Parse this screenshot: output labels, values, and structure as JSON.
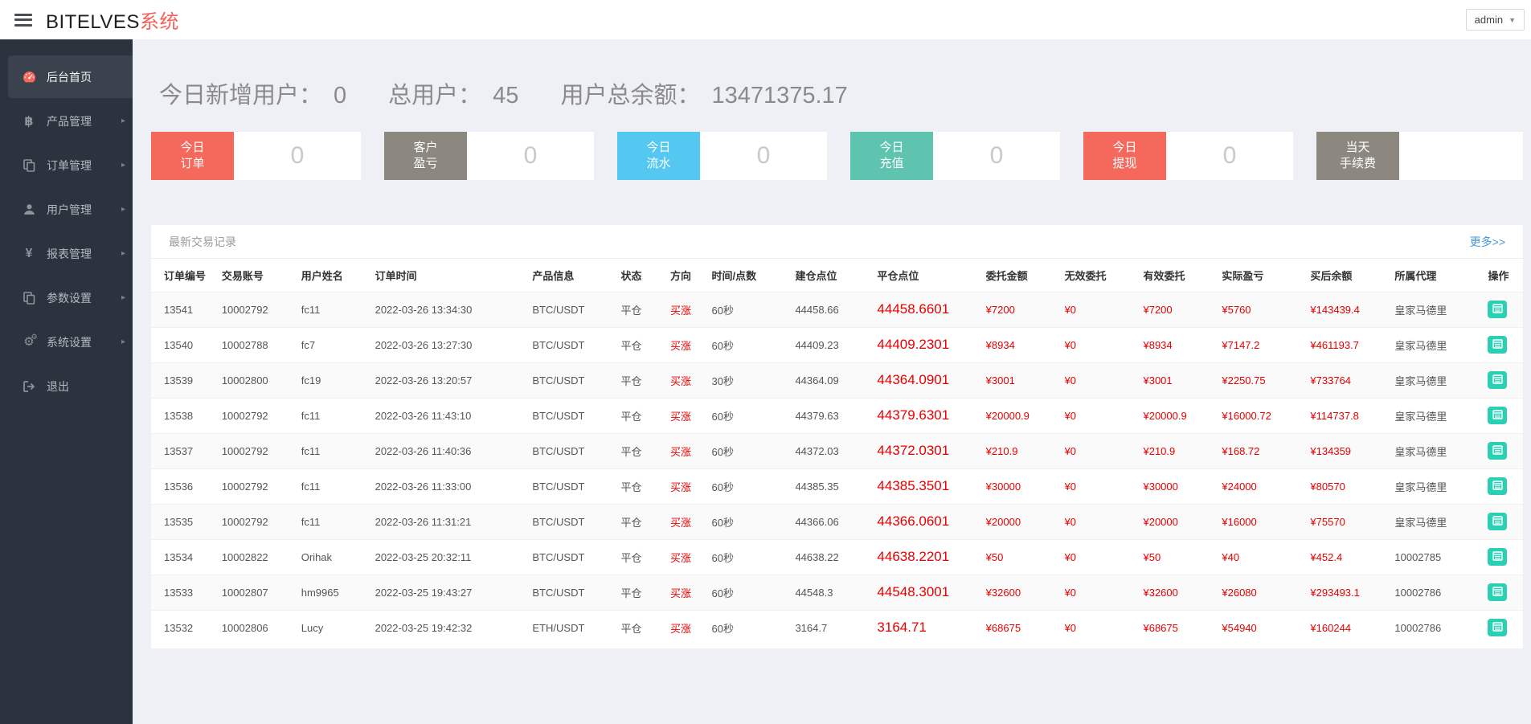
{
  "header": {
    "brand": "BITELVES",
    "brand_suffix": "系统",
    "user_label": "admin"
  },
  "sidebar": {
    "items": [
      {
        "label": "后台首页",
        "icon": "dashboard-icon",
        "active": true,
        "has_arrow": false
      },
      {
        "label": "产品管理",
        "icon": "bitcoin-icon",
        "active": false,
        "has_arrow": true
      },
      {
        "label": "订单管理",
        "icon": "orders-icon",
        "active": false,
        "has_arrow": true
      },
      {
        "label": "用户管理",
        "icon": "user-icon",
        "active": false,
        "has_arrow": true
      },
      {
        "label": "报表管理",
        "icon": "yen-icon",
        "active": false,
        "has_arrow": true
      },
      {
        "label": "参数设置",
        "icon": "params-icon",
        "active": false,
        "has_arrow": true
      },
      {
        "label": "系统设置",
        "icon": "gears-icon",
        "active": false,
        "has_arrow": true
      },
      {
        "label": "退出",
        "icon": "logout-icon",
        "active": false,
        "has_arrow": false
      }
    ]
  },
  "stats": [
    {
      "label": "今日新增用户：",
      "value": "0"
    },
    {
      "label": "总用户：",
      "value": "45"
    },
    {
      "label": "用户总余额：",
      "value": "13471375.17"
    }
  ],
  "cards": [
    {
      "line1": "今日",
      "line2": "订单",
      "value": "0",
      "color": "#f4695c"
    },
    {
      "line1": "客户",
      "line2": "盈亏",
      "value": "0",
      "color": "#8c8880"
    },
    {
      "line1": "今日",
      "line2": "流水",
      "value": "0",
      "color": "#54c8f0"
    },
    {
      "line1": "今日",
      "line2": "充值",
      "value": "0",
      "color": "#5ec4b0"
    },
    {
      "line1": "今日",
      "line2": "提现",
      "value": "0",
      "color": "#f4695c"
    },
    {
      "line1": "当天",
      "line2": "手续费",
      "value": "",
      "color": "#8c8880"
    }
  ],
  "panel": {
    "title": "最新交易记录",
    "more_link": "更多>>"
  },
  "table": {
    "columns": [
      "订单编号",
      "交易账号",
      "用户姓名",
      "订单时间",
      "产品信息",
      "状态",
      "方向",
      "时间/点数",
      "建仓点位",
      "平仓点位",
      "委托金额",
      "无效委托",
      "有效委托",
      "实际盈亏",
      "买后余额",
      "所属代理",
      "操作"
    ],
    "rows": [
      {
        "id": "13541",
        "account": "10002792",
        "name": "fc11",
        "time": "2022-03-26 13:34:30",
        "product": "BTC/USDT",
        "status": "平仓",
        "direction": "买涨",
        "period": "60秒",
        "open_point": "44458.66",
        "close_point": "44458.6601",
        "amount": "¥7200",
        "invalid": "¥0",
        "valid": "¥7200",
        "profit": "¥5760",
        "balance": "¥143439.4",
        "agent": "皇家马德里"
      },
      {
        "id": "13540",
        "account": "10002788",
        "name": "fc7",
        "time": "2022-03-26 13:27:30",
        "product": "BTC/USDT",
        "status": "平仓",
        "direction": "买涨",
        "period": "60秒",
        "open_point": "44409.23",
        "close_point": "44409.2301",
        "amount": "¥8934",
        "invalid": "¥0",
        "valid": "¥8934",
        "profit": "¥7147.2",
        "balance": "¥461193.7",
        "agent": "皇家马德里"
      },
      {
        "id": "13539",
        "account": "10002800",
        "name": "fc19",
        "time": "2022-03-26 13:20:57",
        "product": "BTC/USDT",
        "status": "平仓",
        "direction": "买涨",
        "period": "30秒",
        "open_point": "44364.09",
        "close_point": "44364.0901",
        "amount": "¥3001",
        "invalid": "¥0",
        "valid": "¥3001",
        "profit": "¥2250.75",
        "balance": "¥733764",
        "agent": "皇家马德里"
      },
      {
        "id": "13538",
        "account": "10002792",
        "name": "fc11",
        "time": "2022-03-26 11:43:10",
        "product": "BTC/USDT",
        "status": "平仓",
        "direction": "买涨",
        "period": "60秒",
        "open_point": "44379.63",
        "close_point": "44379.6301",
        "amount": "¥20000.9",
        "invalid": "¥0",
        "valid": "¥20000.9",
        "profit": "¥16000.72",
        "balance": "¥114737.8",
        "agent": "皇家马德里"
      },
      {
        "id": "13537",
        "account": "10002792",
        "name": "fc11",
        "time": "2022-03-26 11:40:36",
        "product": "BTC/USDT",
        "status": "平仓",
        "direction": "买涨",
        "period": "60秒",
        "open_point": "44372.03",
        "close_point": "44372.0301",
        "amount": "¥210.9",
        "invalid": "¥0",
        "valid": "¥210.9",
        "profit": "¥168.72",
        "balance": "¥134359",
        "agent": "皇家马德里"
      },
      {
        "id": "13536",
        "account": "10002792",
        "name": "fc11",
        "time": "2022-03-26 11:33:00",
        "product": "BTC/USDT",
        "status": "平仓",
        "direction": "买涨",
        "period": "60秒",
        "open_point": "44385.35",
        "close_point": "44385.3501",
        "amount": "¥30000",
        "invalid": "¥0",
        "valid": "¥30000",
        "profit": "¥24000",
        "balance": "¥80570",
        "agent": "皇家马德里"
      },
      {
        "id": "13535",
        "account": "10002792",
        "name": "fc11",
        "time": "2022-03-26 11:31:21",
        "product": "BTC/USDT",
        "status": "平仓",
        "direction": "买涨",
        "period": "60秒",
        "open_point": "44366.06",
        "close_point": "44366.0601",
        "amount": "¥20000",
        "invalid": "¥0",
        "valid": "¥20000",
        "profit": "¥16000",
        "balance": "¥75570",
        "agent": "皇家马德里"
      },
      {
        "id": "13534",
        "account": "10002822",
        "name": "Orihak",
        "time": "2022-03-25 20:32:11",
        "product": "BTC/USDT",
        "status": "平仓",
        "direction": "买涨",
        "period": "60秒",
        "open_point": "44638.22",
        "close_point": "44638.2201",
        "amount": "¥50",
        "invalid": "¥0",
        "valid": "¥50",
        "profit": "¥40",
        "balance": "¥452.4",
        "agent": "10002785"
      },
      {
        "id": "13533",
        "account": "10002807",
        "name": "hm9965",
        "time": "2022-03-25 19:43:27",
        "product": "BTC/USDT",
        "status": "平仓",
        "direction": "买涨",
        "period": "60秒",
        "open_point": "44548.3",
        "close_point": "44548.3001",
        "amount": "¥32600",
        "invalid": "¥0",
        "valid": "¥32600",
        "profit": "¥26080",
        "balance": "¥293493.1",
        "agent": "10002786"
      },
      {
        "id": "13532",
        "account": "10002806",
        "name": "Lucy",
        "time": "2022-03-25 19:42:32",
        "product": "ETH/USDT",
        "status": "平仓",
        "direction": "买涨",
        "period": "60秒",
        "open_point": "3164.7",
        "close_point": "3164.71",
        "amount": "¥68675",
        "invalid": "¥0",
        "valid": "¥68675",
        "profit": "¥54940",
        "balance": "¥160244",
        "agent": "10002786"
      }
    ],
    "op_icon": "list-icon"
  },
  "colors": {
    "accent_red": "#f4695c",
    "value_red": "#e60000",
    "link_blue": "#4898d5",
    "op_teal": "#2bd0b4",
    "sidebar_bg": "#2b333e",
    "page_bg": "#eef0f5"
  }
}
